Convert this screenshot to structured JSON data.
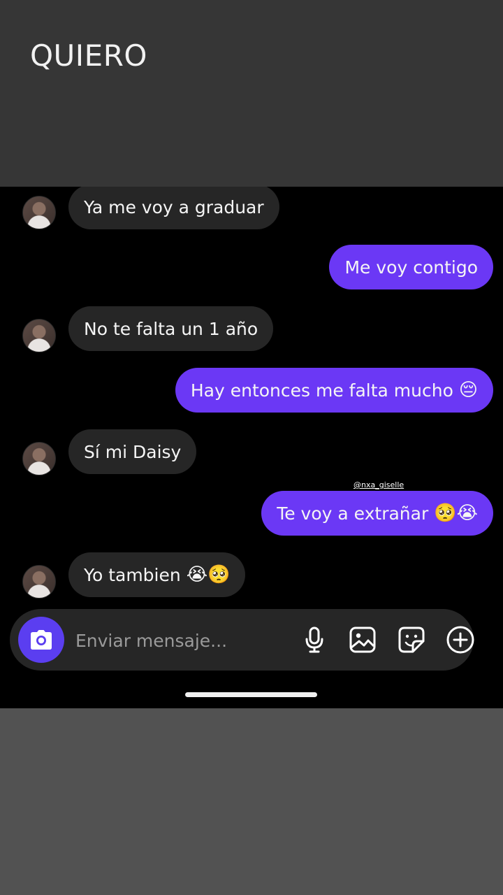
{
  "caption": "QUIERO",
  "watermark": "@nxa_giselle",
  "messages": [
    {
      "side": "in",
      "text": "Ya me voy a graduar",
      "emoji": ""
    },
    {
      "side": "out",
      "text": "Me voy contigo",
      "emoji": ""
    },
    {
      "side": "in",
      "text": "No te falta un 1 año",
      "emoji": ""
    },
    {
      "side": "out",
      "text": "Hay entonces me falta mucho",
      "emoji": "😔"
    },
    {
      "side": "in",
      "text": "Sí mi Daisy",
      "emoji": ""
    },
    {
      "side": "out",
      "text": "Te voy a extrañar",
      "emoji": "🥺😭"
    },
    {
      "side": "in",
      "text": "Yo tambien",
      "emoji": "😭🥺"
    }
  ],
  "composer": {
    "placeholder": "Enviar mensaje...",
    "icons": [
      "camera-icon",
      "microphone-icon",
      "gallery-icon",
      "sticker-icon",
      "plus-icon"
    ]
  },
  "colors": {
    "outgoing_bubble": "#6b38f5",
    "incoming_bubble": "#262626",
    "camera_button": "#5b3ef0"
  }
}
